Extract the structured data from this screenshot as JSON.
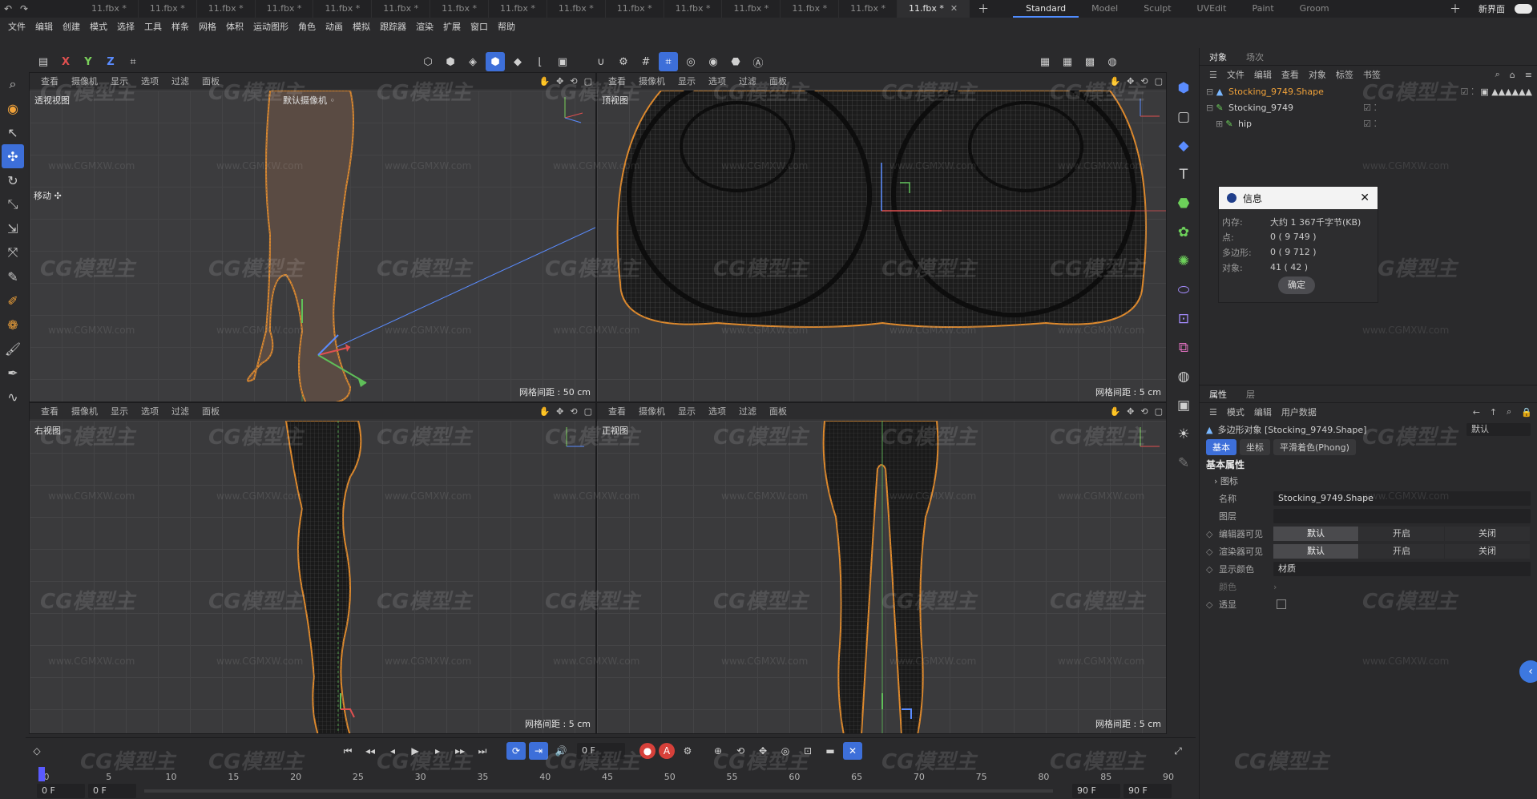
{
  "titlebar": {
    "tabs": [
      "11.fbx *",
      "11.fbx *",
      "11.fbx *",
      "11.fbx *",
      "11.fbx *",
      "11.fbx *",
      "11.fbx *",
      "11.fbx *",
      "11.fbx *",
      "11.fbx *",
      "11.fbx *",
      "11.fbx *",
      "11.fbx *",
      "11.fbx *"
    ],
    "active_tab": "11.fbx *",
    "layouts": [
      "Standard",
      "Model",
      "Sculpt",
      "UVEdit",
      "Paint",
      "Groom"
    ],
    "new_ui": "新界面"
  },
  "menubar": [
    "文件",
    "编辑",
    "创建",
    "模式",
    "选择",
    "工具",
    "样条",
    "网格",
    "体积",
    "运动图形",
    "角色",
    "动画",
    "模拟",
    "跟踪器",
    "渲染",
    "扩展",
    "窗口",
    "帮助"
  ],
  "toolbar": {
    "axis_x": "X",
    "axis_y": "Y",
    "axis_z": "Z"
  },
  "viewports": {
    "menu": [
      "查看",
      "摄像机",
      "显示",
      "选项",
      "过滤",
      "面板"
    ],
    "perspective": {
      "name": "透视视图",
      "camera": "默认摄像机 ◦",
      "grid": "网格间距 : 50 cm"
    },
    "top": {
      "name": "顶视图",
      "grid": "网格间距 : 5 cm"
    },
    "right": {
      "name": "右视图",
      "grid": "网格间距 : 5 cm"
    },
    "front": {
      "name": "正视图",
      "grid": "网格间距 : 5 cm"
    },
    "move_label": "移动 ✣"
  },
  "objects": {
    "tabs": [
      "对象",
      "场次"
    ],
    "menu": [
      "文件",
      "编辑",
      "查看",
      "对象",
      "标签",
      "书签"
    ],
    "rows": [
      {
        "label": "Stocking_9749.Shape",
        "selected": true
      },
      {
        "label": "Stocking_9749",
        "selected": false
      },
      {
        "label": "hip",
        "selected": false
      }
    ]
  },
  "dialog": {
    "title": "信息",
    "rows": [
      {
        "k": "内存:",
        "v": "大约 1 367千字节(KB)"
      },
      {
        "k": "点:",
        "v": "0 ( 9 749 )"
      },
      {
        "k": "多边形:",
        "v": "0 ( 9 712 )"
      },
      {
        "k": "对象:",
        "v": "41 ( 42 )"
      }
    ],
    "ok": "确定"
  },
  "attributes": {
    "tabs": [
      "属性",
      "层"
    ],
    "menu": [
      "模式",
      "编辑",
      "用户数据"
    ],
    "object": "多边形对象 [Stocking_9749.Shape]",
    "mode": "默认",
    "subtabs": [
      "基本",
      "坐标",
      "平滑着色(Phong)"
    ],
    "section": "基本属性",
    "icon_row": "图标",
    "name_label": "名称",
    "name_value": "Stocking_9749.Shape",
    "layer_label": "图层",
    "editor_vis_label": "编辑器可见",
    "render_vis_label": "渲染器可见",
    "vis_options": [
      "默认",
      "开启",
      "关闭"
    ],
    "display_color_label": "显示颜色",
    "display_color_value": "材质",
    "color_label": "颜色",
    "xray_label": "透显"
  },
  "timeline": {
    "frame_field": "0 F",
    "ticks": [
      "0",
      "5",
      "10",
      "15",
      "20",
      "25",
      "30",
      "35",
      "40",
      "45",
      "50",
      "55",
      "60",
      "65",
      "70",
      "75",
      "80",
      "85",
      "90"
    ],
    "start": "0 F",
    "start2": "0 F",
    "end": "90 F",
    "end2": "90 F"
  },
  "watermark": {
    "logo": "CG模型主",
    "url": "www.CGMXW.com"
  }
}
